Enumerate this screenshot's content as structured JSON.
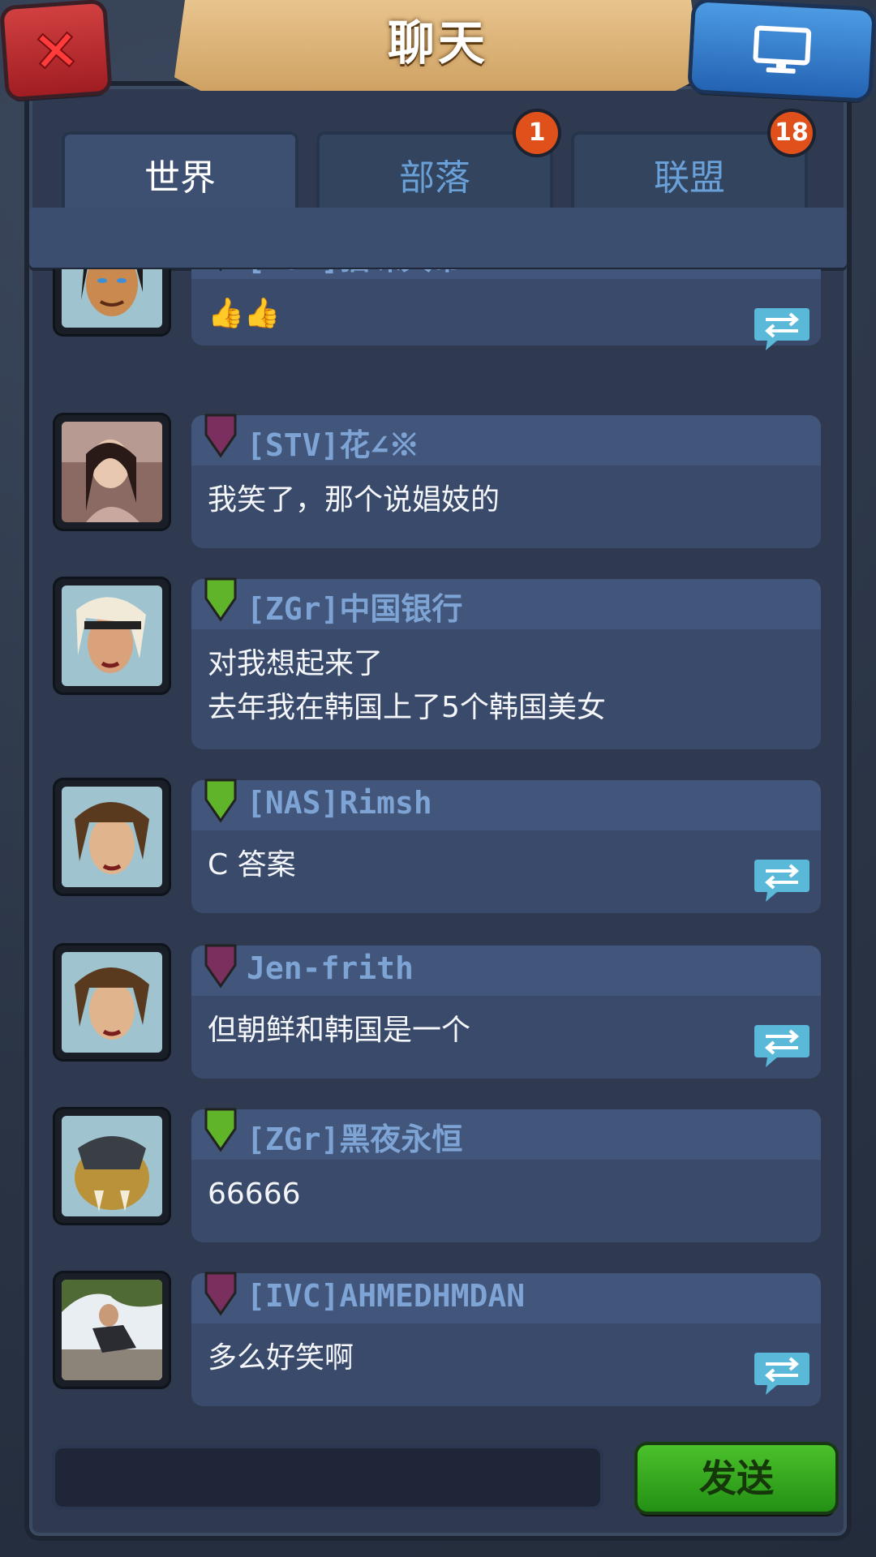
{
  "header": {
    "title": "聊天",
    "close_icon": "close-icon",
    "monitor_icon": "monitor-icon"
  },
  "tabs": [
    {
      "label": "世界",
      "active": true,
      "badge": ""
    },
    {
      "label": "部落",
      "active": false,
      "badge": "1"
    },
    {
      "label": "联盟",
      "active": false,
      "badge": "18"
    }
  ],
  "messages": [
    {
      "sender": "[MJV]猫咪大帝",
      "text": "👍👍",
      "rank_color": "#6e6e6e",
      "translate": true
    },
    {
      "sender": "[STV]花∠※",
      "text": "我笑了，那个说娼妓的",
      "rank_color": "#7a2f5f",
      "translate": false
    },
    {
      "sender": "[ZGr]中国银行",
      "text": "对我想起来了\n去年我在韩国上了5个韩国美女",
      "rank_color": "#5fb42a",
      "translate": false
    },
    {
      "sender": "[NAS]Rimsh",
      "text": "C 答案",
      "rank_color": "#5fb42a",
      "translate": true
    },
    {
      "sender": "Jen-frith",
      "text": "但朝鲜和韩国是一个",
      "rank_color": "#7a2f5f",
      "translate": true
    },
    {
      "sender": "[ZGr]黑夜永恒",
      "text": "66666",
      "rank_color": "#5fb42a",
      "translate": false
    },
    {
      "sender": "[IVC]AHMEDHMDAN",
      "text": "多么好笑啊",
      "rank_color": "#7a2f5f",
      "translate": true
    }
  ],
  "input": {
    "value": ""
  },
  "send_label": "发送"
}
